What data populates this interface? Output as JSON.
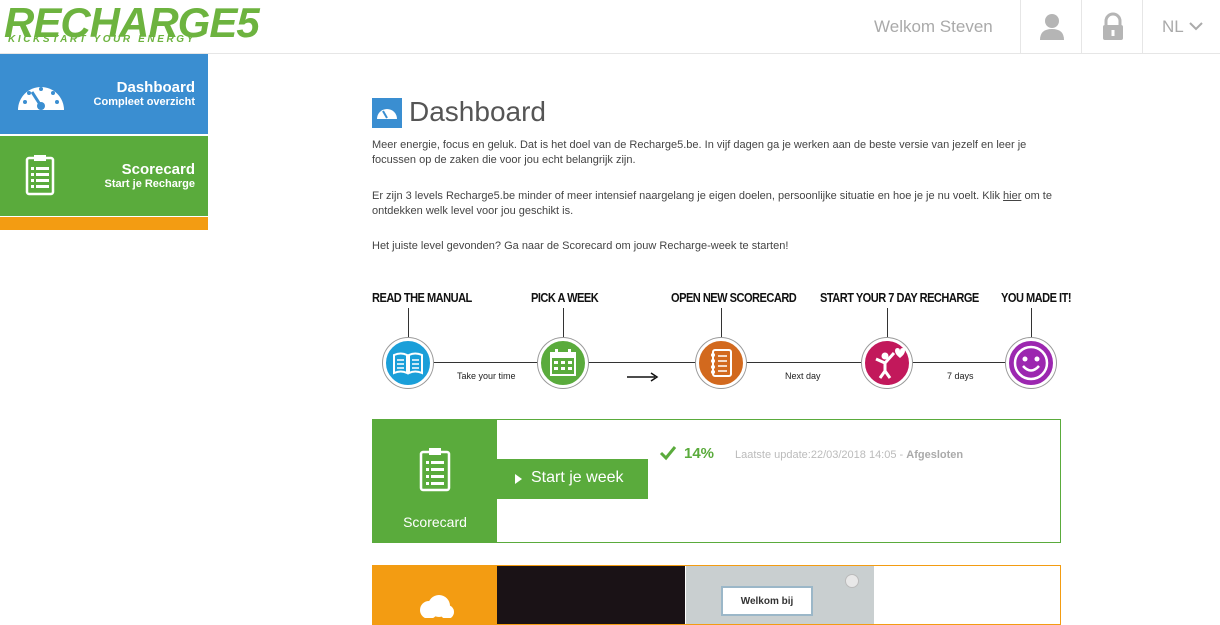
{
  "header": {
    "logo_text": "RECHARGE5",
    "logo_tagline": "KICKSTART YOUR ENERGY",
    "welcome": "Welkom Steven",
    "language": "NL",
    "icons": [
      "user-icon",
      "lock-icon",
      "chevron-down-icon"
    ]
  },
  "sidebar": {
    "items": [
      {
        "title": "Dashboard",
        "subtitle": "Compleet overzicht",
        "icon": "speedometer-icon",
        "color": "#3a8ed1"
      },
      {
        "title": "Scorecard",
        "subtitle": "Start je Recharge",
        "icon": "clipboard-icon",
        "color": "#5aab3c"
      }
    ],
    "accent_bar_color": "#f39c12"
  },
  "main": {
    "title": "Dashboard",
    "paragraphs": {
      "p1": "Meer energie, focus en geluk. Dat is het doel van de Recharge5.be. In vijf dagen ga je werken aan de beste versie van jezelf en leer je focussen op de zaken die voor jou echt belangrijk zijn.",
      "p2_before": "Er zijn 3 levels Recharge5.be minder of meer intensief naargelang je eigen doelen, persoonlijke situatie en hoe je je nu voelt. Klik ",
      "p2_link": "hier",
      "p2_after": " om te ontdekken welk level voor jou geschikt is.",
      "p3": "Het juiste level gevonden? Ga naar de Scorecard om jouw Recharge-week te starten!"
    },
    "steps": [
      {
        "label": "READ THE MANUAL",
        "icon": "book-icon",
        "color": "#1a9fd9"
      },
      {
        "label": "PICK A WEEK",
        "icon": "calendar-icon",
        "color": "#5aab3c"
      },
      {
        "label": "OPEN NEW SCORECARD",
        "icon": "notebook-icon",
        "color": "#d2691e"
      },
      {
        "label": "START YOUR 7 DAY RECHARGE",
        "icon": "heart-person-icon",
        "color": "#c2185b"
      },
      {
        "label": "YOU MADE IT!",
        "icon": "smiley-icon",
        "color": "#9c27b0"
      }
    ],
    "connectors": [
      "Take your time",
      "Next day",
      "7 days"
    ],
    "scorecard": {
      "label": "Scorecard",
      "button": "Start je week",
      "progress_percent": "14%",
      "update_prefix": "Laatste update:22/03/2018 14:05 - ",
      "status": "Afgesloten"
    },
    "next_card": {
      "sign_text": "Welkom bij"
    }
  }
}
